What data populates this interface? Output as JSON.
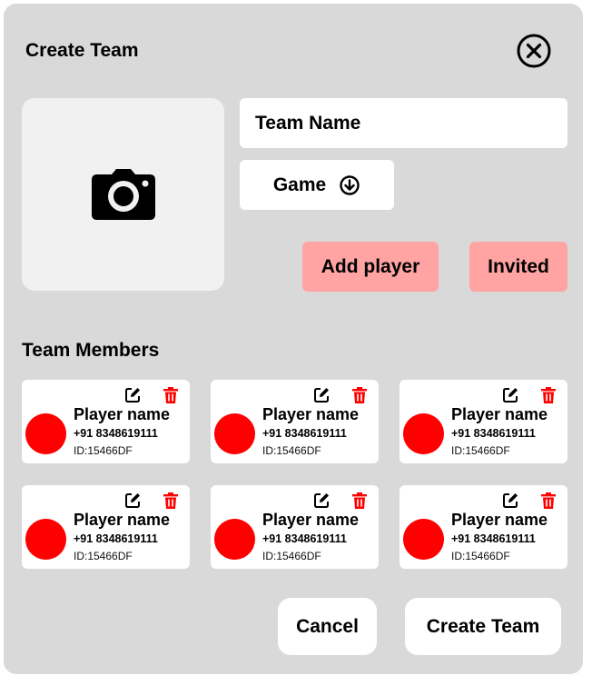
{
  "modal": {
    "title": "Create Team",
    "close_icon": "close-circle-icon",
    "photo_icon": "camera-icon"
  },
  "form": {
    "team_name_placeholder": "Team Name",
    "game_label": "Game",
    "game_icon": "arrow-down-circle-icon",
    "add_player_label": "Add player",
    "invited_label": "Invited",
    "accent_pink": "#ffa3a3"
  },
  "members": {
    "heading": "Team Members",
    "avatar_color": "#ff0000",
    "edit_icon": "edit-icon",
    "delete_icon": "trash-icon",
    "delete_color": "#ff0000",
    "players": [
      {
        "name": "Player name",
        "phone": "+91 8348619111",
        "id": "ID:15466DF"
      },
      {
        "name": "Player name",
        "phone": "+91 8348619111",
        "id": "ID:15466DF"
      },
      {
        "name": "Player name",
        "phone": "+91 8348619111",
        "id": "ID:15466DF"
      },
      {
        "name": "Player name",
        "phone": "+91 8348619111",
        "id": "ID:15466DF"
      },
      {
        "name": "Player name",
        "phone": "+91 8348619111",
        "id": "ID:15466DF"
      },
      {
        "name": "Player name",
        "phone": "+91 8348619111",
        "id": "ID:15466DF"
      }
    ]
  },
  "footer": {
    "cancel_label": "Cancel",
    "create_label": "Create Team"
  }
}
